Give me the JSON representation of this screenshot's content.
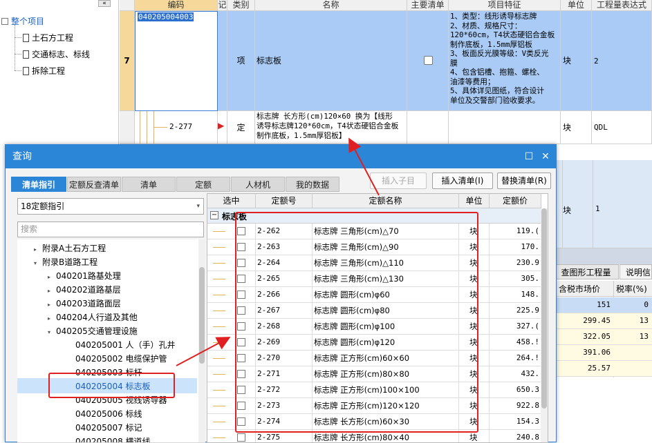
{
  "project_tree": {
    "collapse_label": "«",
    "root": "整个项目",
    "items": [
      "土石方工程",
      "交通标志、标线",
      "拆除工程"
    ]
  },
  "grid": {
    "headers": [
      "编码",
      "记",
      "类别",
      "名称",
      "主要清单",
      "项目特征",
      "单位",
      "工程量表达式"
    ],
    "row1": {
      "num": "7",
      "code": "040205004003",
      "type": "项",
      "name": "标志板",
      "features": [
        "1、类型：线形诱导标志牌",
        "2、材质、规格尺寸：",
        "120*60cm，T4状态硬铝合金板",
        "制作底板，1.5mm厚铝板",
        "3、板面反光膜等级：V类反光",
        "膜",
        "4、包含铝槽、抱箍、螺栓、",
        "油漆等费用；",
        "5、具体详见图纸，符合设计",
        "单位及交警部门验收要求。"
      ],
      "unit": "块",
      "expr": "2"
    },
    "row2": {
      "code": "2-277",
      "type": "定",
      "name_lines": [
        "标志牌 长方形(cm)120×60  换为【线形",
        "诱导标志牌120*60cm，T4状态硬铝合金板",
        "制作底板，1.5mm厚铝板】"
      ],
      "unit": "块",
      "expr": "QDL"
    },
    "row3": {
      "unit": "块",
      "expr": "1"
    }
  },
  "right_panel": {
    "tabs": [
      "查图形工程量",
      "说明信"
    ],
    "headers": [
      "含税市场价",
      "税率(%)"
    ],
    "rows": [
      [
        "151",
        "0"
      ],
      [
        "299.45",
        "13"
      ],
      [
        "322.05",
        "13"
      ],
      [
        "391.06",
        ""
      ],
      [
        "25.57",
        ""
      ]
    ]
  },
  "dialog": {
    "title": "查询",
    "tabs": [
      "清单指引",
      "定额反查清单",
      "清单",
      "定额",
      "人材机",
      "我的数据"
    ],
    "buttons": {
      "insert_child": "插入子目",
      "insert_list": "插入清单(I)",
      "replace_list": "替换清单(R)"
    },
    "combo_value": "18定额指引",
    "search_placeholder": "搜索",
    "tree": [
      {
        "label": "附录A土石方工程",
        "level": 1,
        "arrow": "▸"
      },
      {
        "label": "附录B道路工程",
        "level": 1,
        "arrow": "▾"
      },
      {
        "label": "040201路基处理",
        "level": 2,
        "arrow": "▸"
      },
      {
        "label": "040202道路基层",
        "level": 2,
        "arrow": "▸"
      },
      {
        "label": "040203道路面层",
        "level": 2,
        "arrow": "▸"
      },
      {
        "label": "040204人行道及其他",
        "level": 2,
        "arrow": "▸"
      },
      {
        "label": "040205交通管理设施",
        "level": 2,
        "arrow": "▾"
      },
      {
        "label": "040205001  人（手）孔井",
        "level": 3,
        "arrow": ""
      },
      {
        "label": "040205002  电缆保护管",
        "level": 3,
        "arrow": ""
      },
      {
        "label": "040205003  标杆",
        "level": 3,
        "arrow": ""
      },
      {
        "label": "040205004  标志板",
        "level": 3,
        "arrow": "",
        "selected": true
      },
      {
        "label": "040205005  视线诱导器",
        "level": 3,
        "arrow": ""
      },
      {
        "label": "040205006  标线",
        "level": 3,
        "arrow": ""
      },
      {
        "label": "040205007  标记",
        "level": 3,
        "arrow": ""
      },
      {
        "label": "040205008  横道线",
        "level": 3,
        "arrow": ""
      }
    ],
    "table_headers": [
      "选中",
      "定额号",
      "定额名称",
      "单位",
      "定额价"
    ],
    "group_label": "标志板",
    "group_toggle": "−",
    "rows": [
      {
        "code": "2-262",
        "name": "标志牌 三角形(cm)△70",
        "unit": "块",
        "price": "119.("
      },
      {
        "code": "2-263",
        "name": "标志牌 三角形(cm)△90",
        "unit": "块",
        "price": "170."
      },
      {
        "code": "2-264",
        "name": "标志牌 三角形(cm)△110",
        "unit": "块",
        "price": "230.9"
      },
      {
        "code": "2-265",
        "name": "标志牌 三角形(cm)△130",
        "unit": "块",
        "price": "305."
      },
      {
        "code": "2-266",
        "name": "标志牌 圆形(cm)φ60",
        "unit": "块",
        "price": "148."
      },
      {
        "code": "2-267",
        "name": "标志牌 圆形(cm)φ80",
        "unit": "块",
        "price": "225.9"
      },
      {
        "code": "2-268",
        "name": "标志牌 圆形(cm)φ100",
        "unit": "块",
        "price": "327.("
      },
      {
        "code": "2-269",
        "name": "标志牌 圆形(cm)φ120",
        "unit": "块",
        "price": "458.!"
      },
      {
        "code": "2-270",
        "name": "标志牌 正方形(cm)60×60",
        "unit": "块",
        "price": "264.!"
      },
      {
        "code": "2-271",
        "name": "标志牌 正方形(cm)80×80",
        "unit": "块",
        "price": "432."
      },
      {
        "code": "2-272",
        "name": "标志牌 正方形(cm)100×100",
        "unit": "块",
        "price": "650.3"
      },
      {
        "code": "2-273",
        "name": "标志牌 正方形(cm)120×120",
        "unit": "块",
        "price": "922.8"
      },
      {
        "code": "2-274",
        "name": "标志牌 长方形(cm)60×30",
        "unit": "块",
        "price": "154.3"
      },
      {
        "code": "2-275",
        "name": "标志牌 长方形(cm)80×40",
        "unit": "块",
        "price": "240.8"
      }
    ]
  }
}
